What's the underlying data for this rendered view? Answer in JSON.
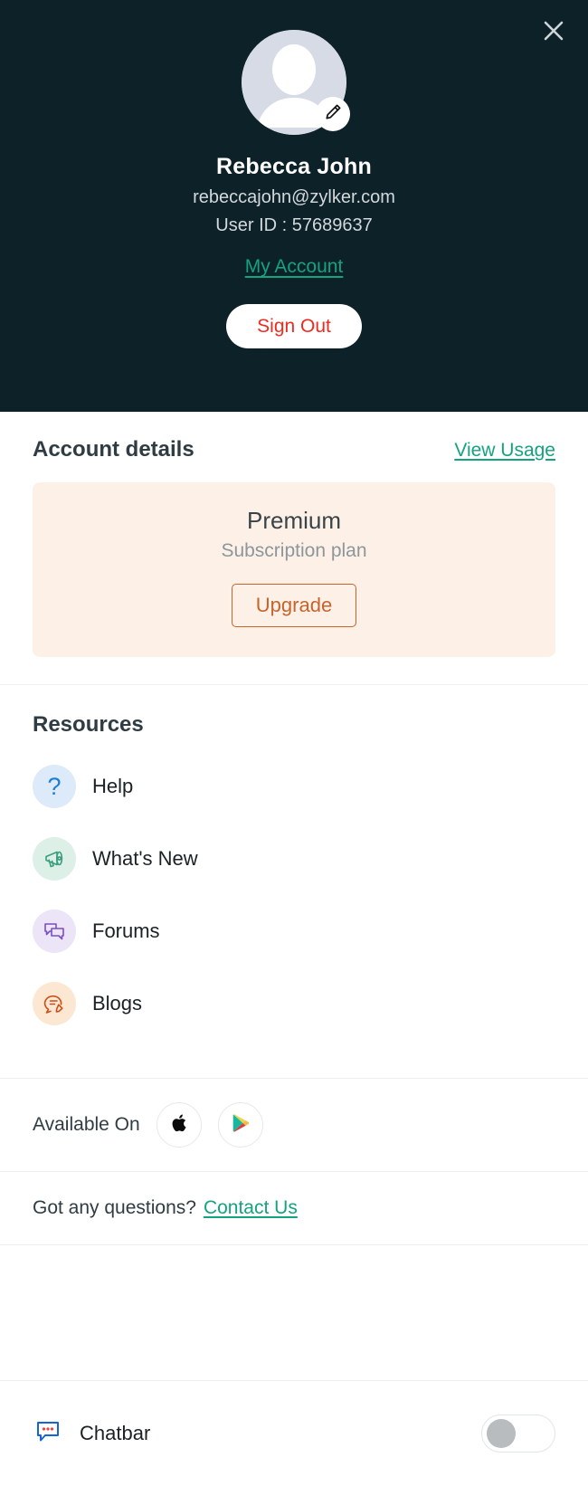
{
  "header": {
    "close_icon": "close-icon",
    "avatar_icon": "user-avatar-placeholder",
    "edit_icon": "pencil-edit-icon",
    "name": "Rebecca John",
    "email": "rebeccajohn@zylker.com",
    "user_id": "User ID : 57689637",
    "my_account_link": "My Account",
    "sign_out_label": "Sign Out",
    "bg_color": "#0d2129",
    "link_color": "#14a37f",
    "signout_color": "#ee2b22"
  },
  "account": {
    "title": "Account details",
    "view_usage_label": "View Usage",
    "plan_name": "Premium",
    "plan_subtitle": "Subscription plan",
    "upgrade_label": "Upgrade",
    "card_bg": "#fdf1e7",
    "upgrade_color": "#c9632c"
  },
  "resources": {
    "title": "Resources",
    "items": [
      {
        "label": "Help",
        "icon": "question-mark-icon",
        "icon_bg": "#dceaf9",
        "icon_color": "#1e7fd4"
      },
      {
        "label": "What's New",
        "icon": "megaphone-icon",
        "icon_bg": "#ddf0e7",
        "icon_color": "#3a9e7e"
      },
      {
        "label": "Forums",
        "icon": "chat-bubbles-icon",
        "icon_bg": "#ece4f7",
        "icon_color": "#7b4fc4"
      },
      {
        "label": "Blogs",
        "icon": "blog-pencil-icon",
        "icon_bg": "#fce7d3",
        "icon_color": "#cc4e17"
      }
    ]
  },
  "available_on": {
    "label": "Available On",
    "stores": [
      {
        "name": "apple-app-store-icon"
      },
      {
        "name": "google-play-store-icon"
      }
    ]
  },
  "contact": {
    "question_text": "Got any questions?",
    "link_label": "Contact Us"
  },
  "chatbar": {
    "icon": "chatbar-icon",
    "label": "Chatbar",
    "toggle_state": "off"
  }
}
